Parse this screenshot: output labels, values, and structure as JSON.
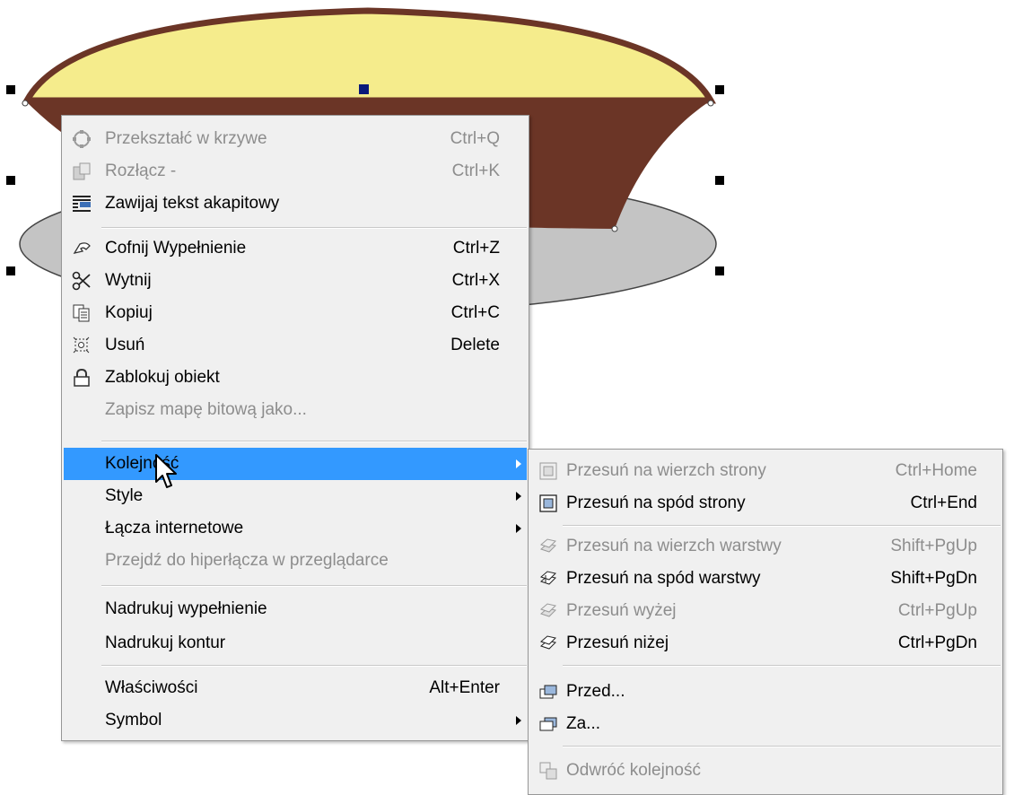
{
  "context_menu": {
    "items": [
      {
        "label": "Przekształć w krzywe",
        "shortcut": "Ctrl+Q",
        "disabled": true,
        "icon": "convert-curves-icon"
      },
      {
        "label": "Rozłącz -",
        "shortcut": "Ctrl+K",
        "disabled": true,
        "icon": "break-apart-icon"
      },
      {
        "label": "Zawijaj tekst akapitowy",
        "shortcut": "",
        "disabled": false,
        "icon": "wrap-text-icon"
      },
      {
        "label": "Cofnij Wypełnienie",
        "shortcut": "Ctrl+Z",
        "disabled": false,
        "icon": "undo-icon"
      },
      {
        "label": "Wytnij",
        "shortcut": "Ctrl+X",
        "disabled": false,
        "icon": "scissors-icon"
      },
      {
        "label": "Kopiuj",
        "shortcut": "Ctrl+C",
        "disabled": false,
        "icon": "copy-icon"
      },
      {
        "label": "Usuń",
        "shortcut": "Delete",
        "disabled": false,
        "icon": "delete-icon"
      },
      {
        "label": "Zablokuj obiekt",
        "shortcut": "",
        "disabled": false,
        "icon": "lock-icon"
      },
      {
        "label": "Zapisz mapę bitową jako...",
        "shortcut": "",
        "disabled": true
      },
      {
        "label": "Kolejność",
        "highlighted": true,
        "submenu": true
      },
      {
        "label": "Style",
        "submenu": true
      },
      {
        "label": "Łącza internetowe",
        "submenu": true
      },
      {
        "label": "Przejdź do hiperłącza w przeglądarce",
        "disabled": true
      },
      {
        "label": "Nadrukuj wypełnienie"
      },
      {
        "label": "Nadrukuj kontur"
      },
      {
        "label": "Właściwości",
        "shortcut": "Alt+Enter"
      },
      {
        "label": "Symbol",
        "submenu": true
      }
    ]
  },
  "order_submenu": {
    "items": [
      {
        "label": "Przesuń na wierzch strony",
        "shortcut": "Ctrl+Home",
        "disabled": true,
        "icon": "to-front-of-page-icon"
      },
      {
        "label": "Przesuń na spód strony",
        "shortcut": "Ctrl+End",
        "disabled": false,
        "icon": "to-back-of-page-icon"
      },
      {
        "label": "Przesuń na wierzch warstwy",
        "shortcut": "Shift+PgUp",
        "disabled": true,
        "icon": "to-front-of-layer-icon"
      },
      {
        "label": "Przesuń na spód warstwy",
        "shortcut": "Shift+PgDn",
        "disabled": false,
        "icon": "to-back-of-layer-icon"
      },
      {
        "label": "Przesuń wyżej",
        "shortcut": "Ctrl+PgUp",
        "disabled": true,
        "icon": "forward-one-icon"
      },
      {
        "label": "Przesuń niżej",
        "shortcut": "Ctrl+PgDn",
        "disabled": false,
        "icon": "back-one-icon"
      },
      {
        "label": "Przed...",
        "shortcut": "",
        "disabled": false,
        "icon": "in-front-of-icon"
      },
      {
        "label": "Za...",
        "shortcut": "",
        "disabled": false,
        "icon": "behind-icon"
      },
      {
        "label": "Odwróć kolejność",
        "shortcut": "",
        "disabled": true,
        "icon": "reverse-order-icon"
      }
    ]
  },
  "colors": {
    "bowl_rim": "#f5ec8c",
    "bowl_body": "#6b3526",
    "plate": "#c4c4c4",
    "highlight": "#3399ff"
  }
}
